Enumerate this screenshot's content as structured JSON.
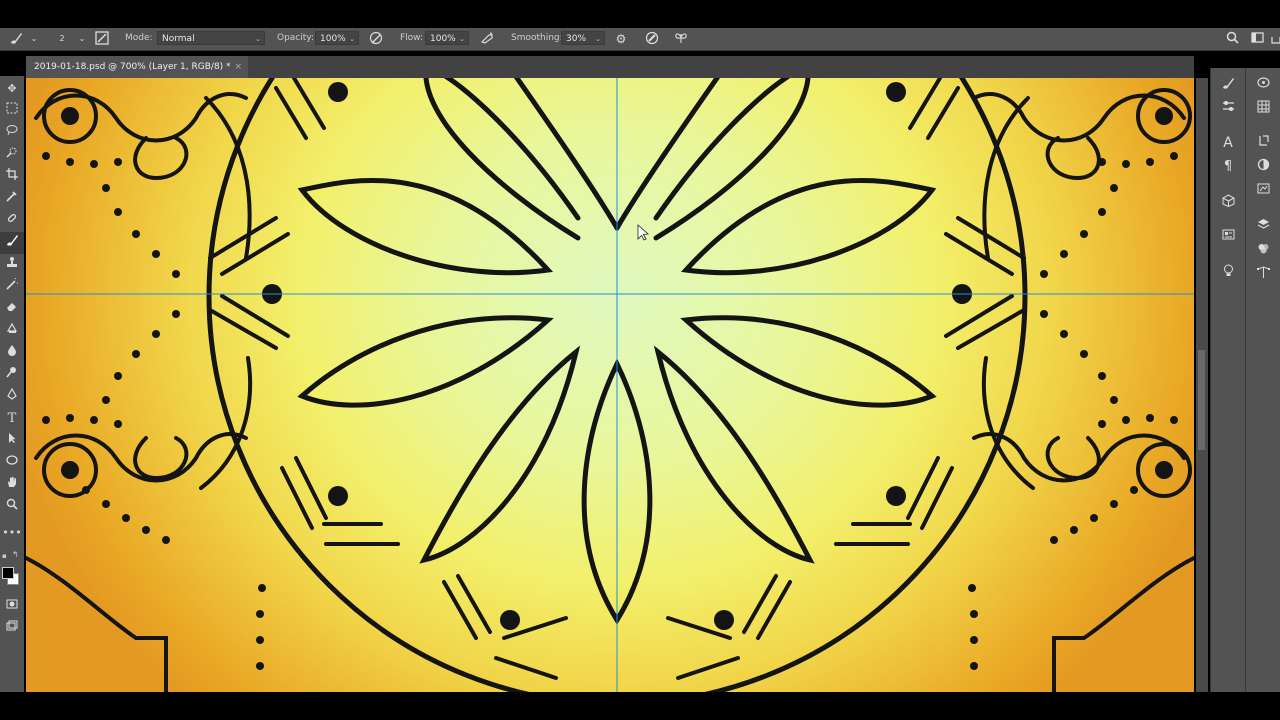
{
  "document_tab": {
    "title": "2019-01-18.psd @ 700% (Layer 1, RGB/8) *",
    "close": "×"
  },
  "options_bar": {
    "brush_size": "2",
    "mode": {
      "label": "Mode:",
      "value": "Normal"
    },
    "opacity": {
      "label": "Opacity:",
      "value": "100%"
    },
    "flow": {
      "label": "Flow:",
      "value": "100%"
    },
    "smoothing": {
      "label": "Smoothing:",
      "value": "30%"
    }
  },
  "icons": {
    "brush": "brush-icon",
    "brush_panel": "brush-settings-icon",
    "pressure_opacity": "pressure-opacity-icon",
    "airbrush": "airbrush-icon",
    "smoothing_settings": "gear-icon",
    "pressure_size": "pressure-size-icon",
    "symmetry": "butterfly-icon",
    "search": "search-icon",
    "workspace": "workspace-icon",
    "share": "share-icon"
  },
  "toolbar": {
    "tools": [
      "move",
      "marquee",
      "lasso",
      "quick-select",
      "crop",
      "eyedropper",
      "healing",
      "brush",
      "stamp",
      "history-brush",
      "eraser",
      "gradient",
      "blur",
      "dodge",
      "pen",
      "type",
      "path-select",
      "shape",
      "hand",
      "zoom",
      "more"
    ],
    "active_tool": "brush",
    "foreground_color": "#000000",
    "background_color": "#ffffff"
  },
  "panels": {
    "column_a": [
      "brushes",
      "brush-settings",
      "character",
      "paragraph",
      "3d",
      "properties",
      "learn"
    ],
    "column_b": [
      "color",
      "swatches",
      "history",
      "adjustments",
      "libraries",
      "layers",
      "channels",
      "paths"
    ]
  },
  "colors": {
    "ui_dark": "#535353",
    "guide": "#1e90d6",
    "ink": "#111111"
  }
}
